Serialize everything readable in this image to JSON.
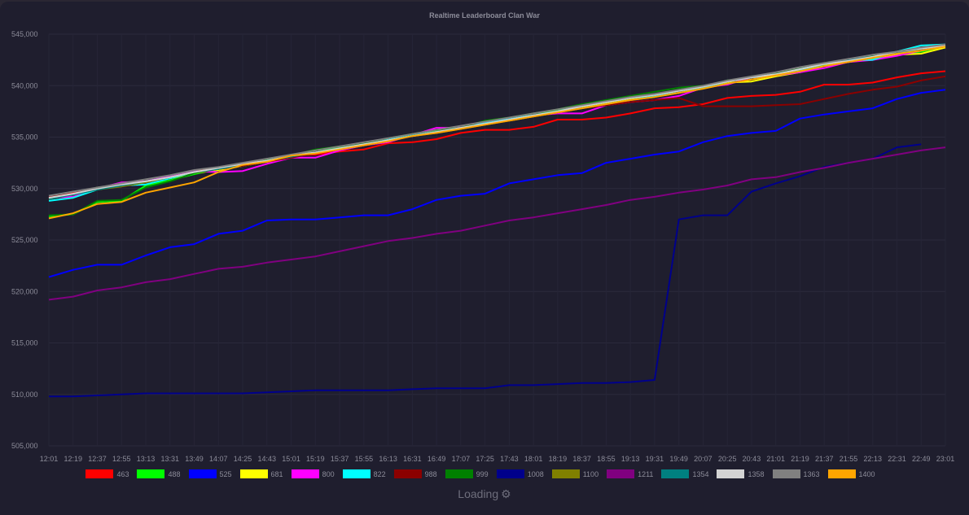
{
  "title": "Realtime Leaderboard Clan War",
  "loading_text": "Loading",
  "loading_icon": "gear-icon",
  "chart_data": {
    "type": "line",
    "title": "Realtime Leaderboard Clan War",
    "xlabel": "",
    "ylabel": "",
    "ylim": [
      505000,
      545000
    ],
    "yticks": [
      505000,
      510000,
      515000,
      520000,
      525000,
      530000,
      535000,
      540000,
      545000
    ],
    "ytick_labels": [
      "505,000",
      "510,000",
      "515,000",
      "520,000",
      "525,000",
      "530,000",
      "535,000",
      "540,000",
      "545,000"
    ],
    "grid": true,
    "legend_position": "bottom",
    "categories": [
      "12:01",
      "12:19",
      "12:37",
      "12:55",
      "13:13",
      "13:31",
      "13:49",
      "14:07",
      "14:25",
      "14:43",
      "15:01",
      "15:19",
      "15:37",
      "15:55",
      "16:13",
      "16:31",
      "16:49",
      "17:07",
      "17:25",
      "17:43",
      "18:01",
      "18:19",
      "18:37",
      "18:55",
      "19:13",
      "19:31",
      "19:49",
      "20:07",
      "20:25",
      "20:43",
      "21:01",
      "21:19",
      "21:37",
      "21:55",
      "22:13",
      "22:31",
      "22:49",
      "23:01"
    ],
    "series": [
      {
        "name": "463",
        "color": "#ff0000",
        "values": [
          529100,
          529600,
          530000,
          530300,
          530700,
          531100,
          531700,
          532000,
          532300,
          532700,
          533200,
          533300,
          533600,
          533800,
          534400,
          534500,
          534800,
          535400,
          535700,
          535700,
          536000,
          536700,
          536700,
          536900,
          537300,
          537800,
          537900,
          538200,
          538800,
          539000,
          539100,
          539400,
          540100,
          540100,
          540300,
          540800,
          541200,
          541400
        ]
      },
      {
        "name": "488",
        "color": "#00ff00",
        "values": [
          527300,
          527500,
          528700,
          528800,
          530300,
          530800,
          531400,
          531900,
          532400,
          532800,
          533200,
          533700,
          534000,
          534300,
          534800,
          535300,
          535600,
          535800,
          536500,
          536800,
          537300,
          537600,
          538100,
          538400,
          538700,
          539100,
          539600,
          539900,
          540500,
          540800,
          541100,
          541400,
          542000,
          542300,
          542600,
          543000,
          543300,
          543700
        ]
      },
      {
        "name": "525",
        "color": "#0000ff",
        "values": [
          521400,
          522100,
          522600,
          522600,
          523500,
          524300,
          524600,
          525600,
          525900,
          526900,
          527000,
          527000,
          527200,
          527400,
          527400,
          528000,
          528900,
          529300,
          529500,
          530500,
          530900,
          531300,
          531500,
          532500,
          532900,
          533300,
          533600,
          534500,
          535100,
          535400,
          535600,
          536800,
          537200,
          537500,
          537800,
          538700,
          539300,
          539600
        ]
      },
      {
        "name": "681",
        "color": "#ffff00",
        "values": [
          529000,
          529400,
          530100,
          530300,
          530700,
          531000,
          531500,
          531800,
          532200,
          532600,
          533000,
          533500,
          533800,
          534200,
          534700,
          535100,
          535500,
          535900,
          536300,
          536600,
          537000,
          537400,
          537900,
          538300,
          538700,
          539000,
          539300,
          539800,
          540300,
          540400,
          540900,
          541300,
          541900,
          542300,
          542700,
          543000,
          543100,
          543700
        ]
      },
      {
        "name": "800",
        "color": "#ff00ff",
        "values": [
          529100,
          529200,
          530000,
          530600,
          530700,
          531200,
          531700,
          531600,
          531700,
          532400,
          533000,
          533000,
          533700,
          534200,
          534500,
          535200,
          535900,
          535900,
          536500,
          536700,
          537100,
          537300,
          537300,
          538100,
          538400,
          538600,
          539000,
          539800,
          540100,
          540800,
          541000,
          541300,
          541700,
          542300,
          542500,
          542900,
          543400,
          543800
        ]
      },
      {
        "name": "822",
        "color": "#00ffff",
        "values": [
          528800,
          529100,
          529900,
          530300,
          530400,
          531000,
          531600,
          531900,
          532300,
          532700,
          533100,
          533500,
          533900,
          534300,
          534800,
          535200,
          535500,
          535900,
          536400,
          536800,
          537100,
          537500,
          538000,
          538400,
          538800,
          539000,
          539300,
          539800,
          540400,
          540800,
          541000,
          541500,
          542100,
          542500,
          542500,
          543300,
          543900,
          544000
        ]
      },
      {
        "name": "988",
        "color": "#8b0000",
        "values": [
          529200,
          529700,
          530000,
          530200,
          530600,
          531100,
          531600,
          531900,
          532200,
          532600,
          533000,
          533400,
          533800,
          534200,
          534600,
          535100,
          535400,
          535800,
          536200,
          536600,
          537000,
          537400,
          537800,
          538100,
          538400,
          538600,
          538800,
          538000,
          538000,
          538000,
          538100,
          538200,
          538700,
          539200,
          539600,
          539900,
          540500,
          540900
        ]
      },
      {
        "name": "999",
        "color": "#008000",
        "values": [
          527400,
          527500,
          528800,
          528900,
          530100,
          530700,
          531500,
          531900,
          532400,
          532900,
          533200,
          533800,
          534100,
          534400,
          534900,
          535300,
          535700,
          535900,
          536600,
          536900,
          537300,
          537700,
          538200,
          538600,
          539000,
          539400,
          539800,
          540000,
          540400,
          540900,
          541200,
          541700,
          542200,
          542500,
          542900,
          543300,
          543600,
          543900
        ]
      },
      {
        "name": "1008",
        "color": "#00008b",
        "values": [
          509800,
          509800,
          509900,
          510000,
          510100,
          510100,
          510100,
          510100,
          510100,
          510200,
          510300,
          510400,
          510400,
          510400,
          510400,
          510500,
          510600,
          510600,
          510600,
          510900,
          510900,
          511000,
          511100,
          511100,
          511200,
          511400,
          527000,
          527400,
          527400,
          529700,
          530500,
          531200,
          532100,
          532500,
          532900,
          534000,
          534300,
          null
        ]
      },
      {
        "name": "1100",
        "color": "#808000",
        "values": [
          529000,
          529400,
          529900,
          530200,
          530600,
          531100,
          531600,
          531900,
          532300,
          532700,
          533100,
          533500,
          533900,
          534300,
          534700,
          535100,
          535400,
          535800,
          536200,
          536600,
          537000,
          537400,
          537800,
          538200,
          538600,
          538900,
          539300,
          539700,
          540200,
          540600,
          541000,
          541400,
          541900,
          542300,
          542700,
          543100,
          543400,
          543800
        ]
      },
      {
        "name": "1211",
        "color": "#800080",
        "values": [
          519200,
          519500,
          520100,
          520400,
          520900,
          521200,
          521700,
          522200,
          522400,
          522800,
          523100,
          523400,
          523900,
          524400,
          524900,
          525200,
          525600,
          525900,
          526400,
          526900,
          527200,
          527600,
          528000,
          528400,
          528900,
          529200,
          529600,
          529900,
          530300,
          530900,
          531100,
          531600,
          532000,
          532500,
          532900,
          533300,
          533700,
          534000
        ]
      },
      {
        "name": "1354",
        "color": "#008080",
        "values": [
          529000,
          529400,
          529900,
          530300,
          530700,
          531100,
          531600,
          531900,
          532300,
          532700,
          533100,
          533500,
          533900,
          534300,
          534700,
          535100,
          535500,
          535900,
          536300,
          536700,
          537100,
          537500,
          538000,
          538400,
          538800,
          539100,
          539500,
          539900,
          540400,
          540800,
          541100,
          541600,
          542100,
          542500,
          542800,
          543200,
          543600,
          543900
        ]
      },
      {
        "name": "1358",
        "color": "#d3d3d3",
        "values": [
          529100,
          529500,
          530000,
          530400,
          530700,
          531100,
          531600,
          532000,
          532400,
          532700,
          533200,
          533500,
          533900,
          534300,
          534700,
          535100,
          535500,
          535900,
          536300,
          536700,
          537100,
          537500,
          538000,
          538400,
          538800,
          539100,
          539500,
          539900,
          540400,
          540800,
          541100,
          541600,
          542100,
          542400,
          542800,
          543300,
          543600,
          543900
        ]
      },
      {
        "name": "1363",
        "color": "#808080",
        "values": [
          529300,
          529700,
          530100,
          530500,
          530900,
          531300,
          531800,
          532100,
          532500,
          532900,
          533300,
          533700,
          534100,
          534500,
          534900,
          535300,
          535700,
          536100,
          536500,
          536900,
          537300,
          537700,
          538100,
          538500,
          538900,
          539200,
          539600,
          540000,
          540500,
          540900,
          541300,
          541800,
          542200,
          542600,
          543000,
          543300,
          543700,
          544000
        ]
      },
      {
        "name": "1400",
        "color": "#ffa500",
        "values": [
          527100,
          527600,
          528500,
          528700,
          529600,
          530100,
          530600,
          531600,
          532300,
          532600,
          533200,
          533400,
          533800,
          534200,
          534600,
          535100,
          535400,
          535800,
          536200,
          536600,
          537000,
          537400,
          537800,
          538200,
          538600,
          538900,
          539300,
          539700,
          540200,
          540600,
          541000,
          541400,
          541900,
          542300,
          542700,
          543100,
          543400,
          543800
        ]
      }
    ]
  }
}
